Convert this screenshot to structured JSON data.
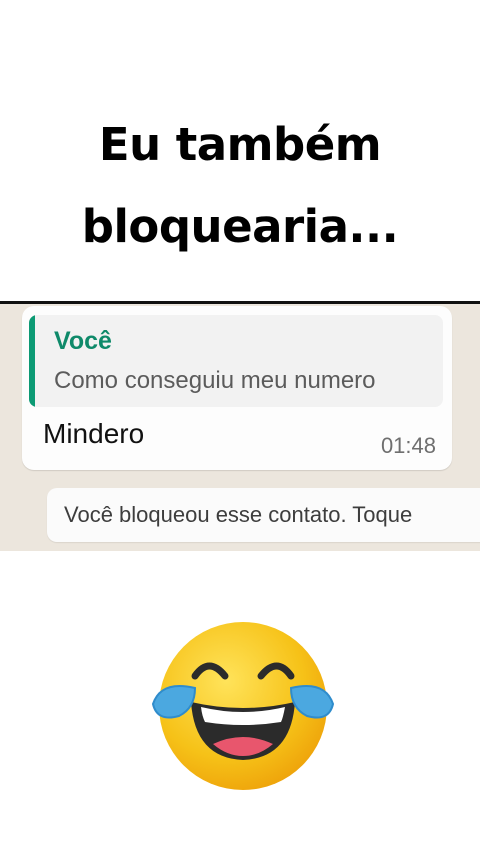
{
  "caption": {
    "line1": "Eu também",
    "line2": "bloquearia..."
  },
  "chat": {
    "quoted_author": "Você",
    "quoted_text": "Como conseguiu meu numero",
    "message_text": "Mindero",
    "message_time": "01:48",
    "system_notice": "Você bloqueou esse contato. Toque"
  },
  "colors": {
    "chat_background": "#ece6dd",
    "quote_accent": "#0c9a74",
    "emoji_face": "#f6c218",
    "emoji_tears": "#4ba8e0"
  },
  "emoji": {
    "icon": "face-with-tears-of-joy-icon"
  }
}
